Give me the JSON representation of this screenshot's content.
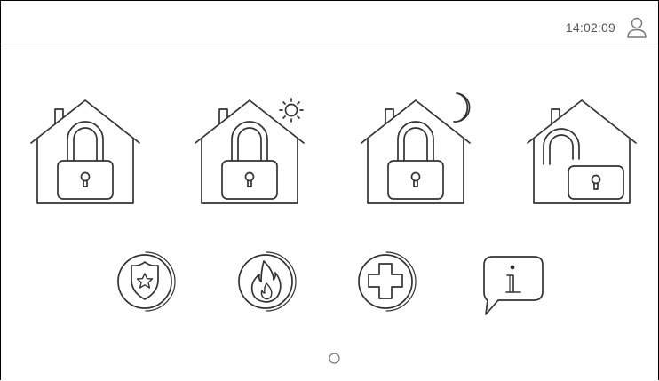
{
  "status_bar": {
    "time": "14:02:09",
    "user_icon": "user-icon"
  },
  "arming_modes": [
    {
      "icon": "house-locked-icon"
    },
    {
      "icon": "house-locked-day-icon"
    },
    {
      "icon": "house-locked-night-icon"
    },
    {
      "icon": "house-unlocked-icon"
    }
  ],
  "emergency_actions": [
    {
      "icon": "police-badge-icon"
    },
    {
      "icon": "fire-icon"
    },
    {
      "icon": "medical-cross-icon"
    },
    {
      "icon": "info-icon"
    }
  ],
  "pager": {
    "pages": 1,
    "current": 1
  },
  "colors": {
    "icon_stroke": "#333333",
    "divider": "#e3e3e3",
    "text": "#555555",
    "background": "#ffffff"
  }
}
